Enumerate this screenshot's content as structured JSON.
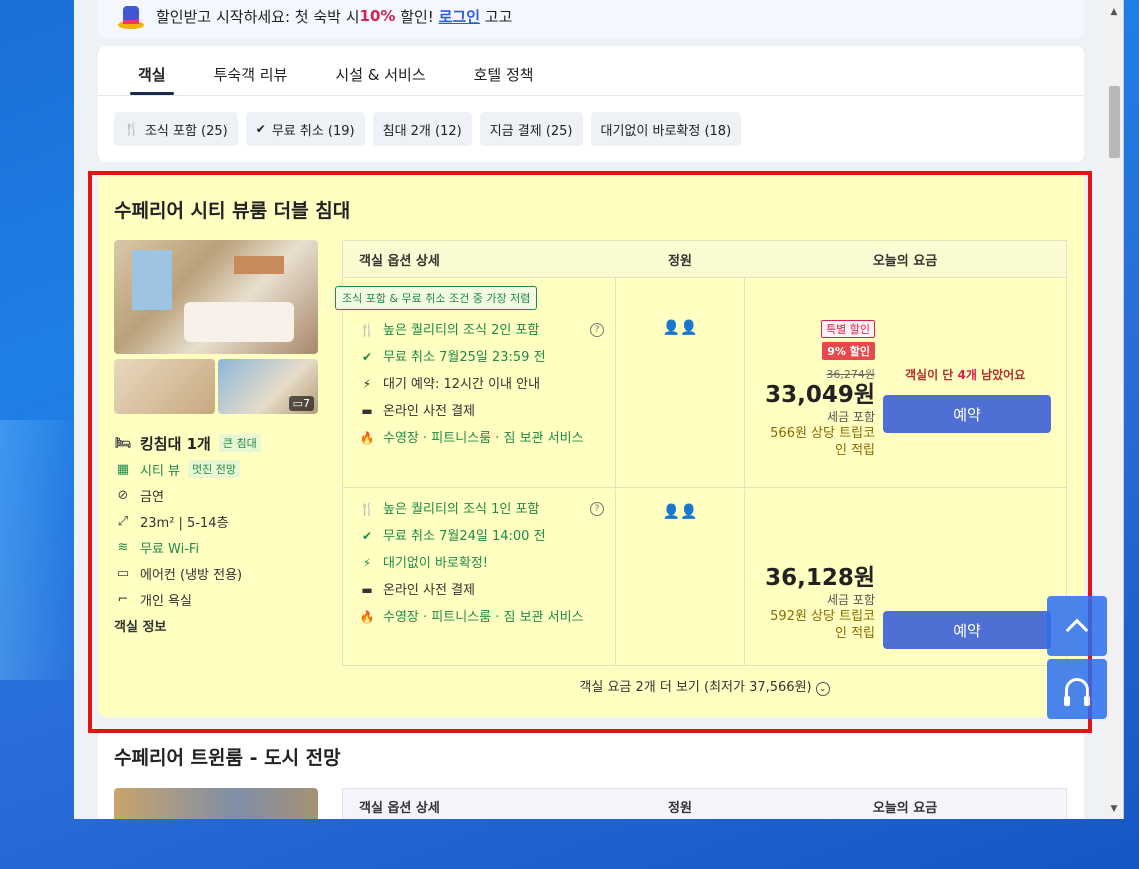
{
  "promo": {
    "text_before": "할인받고 시작하세요: 첫 숙박 시 ",
    "percent": "10%",
    "text_mid": " 할인! ",
    "login": "로그인",
    "text_after": " 고고"
  },
  "tabs": [
    {
      "label": "객실",
      "active": true
    },
    {
      "label": "투숙객 리뷰"
    },
    {
      "label": "시설 & 서비스"
    },
    {
      "label": "호텔 정책"
    }
  ],
  "filters": [
    {
      "icon": "utensils-icon",
      "label": "조식 포함 (25)"
    },
    {
      "icon": "check-circle-icon",
      "label": "무료 취소 (19)"
    },
    {
      "label": "침대 2개 (12)"
    },
    {
      "label": "지금 결제 (25)"
    },
    {
      "label": "대기없이 바로확정 (18)"
    }
  ],
  "room": {
    "title": "수페리어 시티 뷰룸 더블 침대",
    "photo_count": "7",
    "features": {
      "bed": "킹침대 1개",
      "bed_tag": "큰 침대",
      "view": "시티 뷰",
      "view_tag": "멋진 전망",
      "smoking": "금연",
      "size": "23m² | 5-14층",
      "wifi": "무료 Wi-Fi",
      "aircon": "에어컨 (냉방 전용)",
      "bath": "개인 욕실"
    },
    "info_link": "객실 정보",
    "table_headers": {
      "options": "객실 옵션 상세",
      "capacity": "정원",
      "price": "오늘의 요금"
    },
    "rates": [
      {
        "best_tag": "조식 포함 & 무료 취소 조건 중 가장 저렴",
        "breakfast": "높은 퀄리티의 조식 2인 포함",
        "cancel": "무료 취소 7월25일 23:59 전",
        "confirm": "대기 예약: 12시간 이내 안내",
        "payment": "온라인 사전 결제",
        "amenities": "수영장 · 피트니스룸 · 짐 보관 서비스",
        "capacity_icon": "two-guests-icon",
        "special_badge": "특별 할인",
        "discount_badge": "9% 할인",
        "old_price": "36,274원",
        "price": "33,049원",
        "tax": "세금 포함",
        "coin": "566원 상당 트립코인 적립",
        "rooms_left_before": "객실이 단 ",
        "rooms_left_count": "4개",
        "rooms_left_after": " 남았어요",
        "book": "예약"
      },
      {
        "breakfast": "높은 퀄리티의 조식 1인 포함",
        "cancel": "무료 취소 7월24일 14:00 전",
        "confirm": "대기없이 바로확정!",
        "payment": "온라인 사전 결제",
        "amenities": "수영장 · 피트니스룸 · 짐 보관 서비스",
        "capacity_icon": "two-guests-icon",
        "price": "36,128원",
        "tax": "세금 포함",
        "coin": "592원 상당 트립코인 적립",
        "book": "예약"
      }
    ],
    "more_rates": "객실 요금 2개 더 보기 (최저가 37,566원)"
  },
  "room2": {
    "title": "수페리어 트윈룸 - 도시 전망",
    "table_headers": {
      "options": "객실 옵션 상세",
      "capacity": "정원",
      "price": "오늘의 요금"
    }
  },
  "colors": {
    "highlight_bg": "#ffffc2",
    "outline": "#e11414",
    "button": "#4e6fd4",
    "green": "#1f8a4c",
    "discount": "#d9234f"
  }
}
